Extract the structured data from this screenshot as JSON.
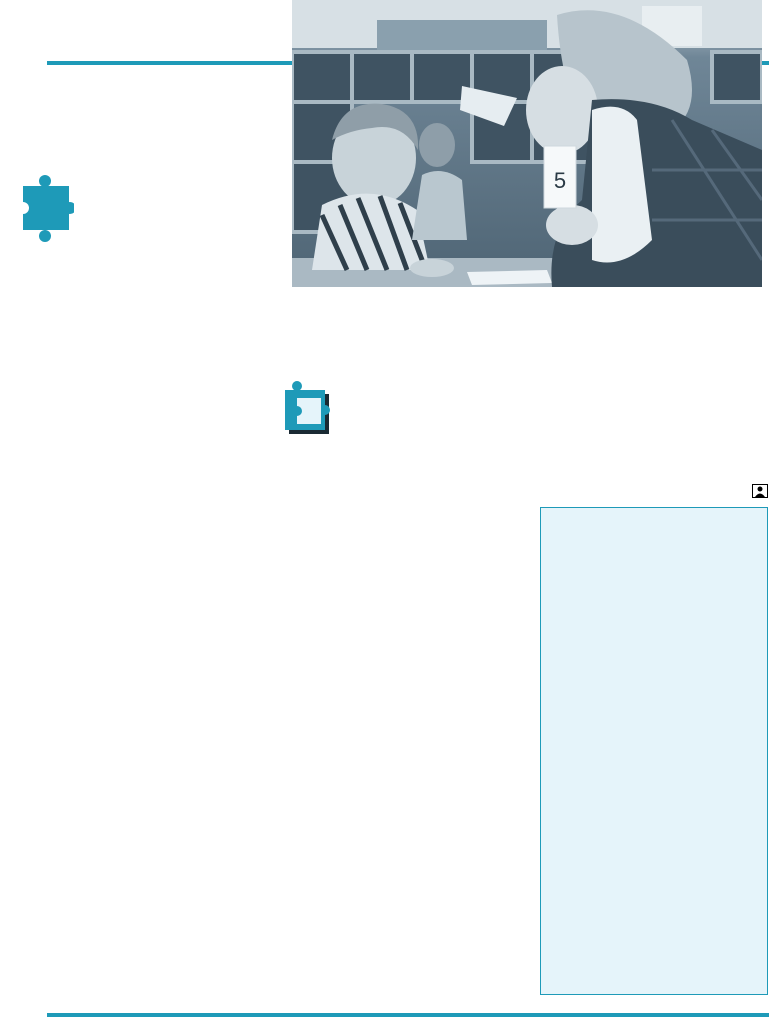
{
  "colors": {
    "accent": "#1e9ab8",
    "sidebar_bg": "#e5f4fa"
  },
  "icons": {
    "section_marker": "puzzle-piece-icon",
    "activity_marker": "puzzle-piece-corner-icon",
    "photo_credit": "portrait-photo-icon"
  },
  "photo": {
    "flash_card_text": "5"
  },
  "sidebar": {
    "text": ""
  }
}
